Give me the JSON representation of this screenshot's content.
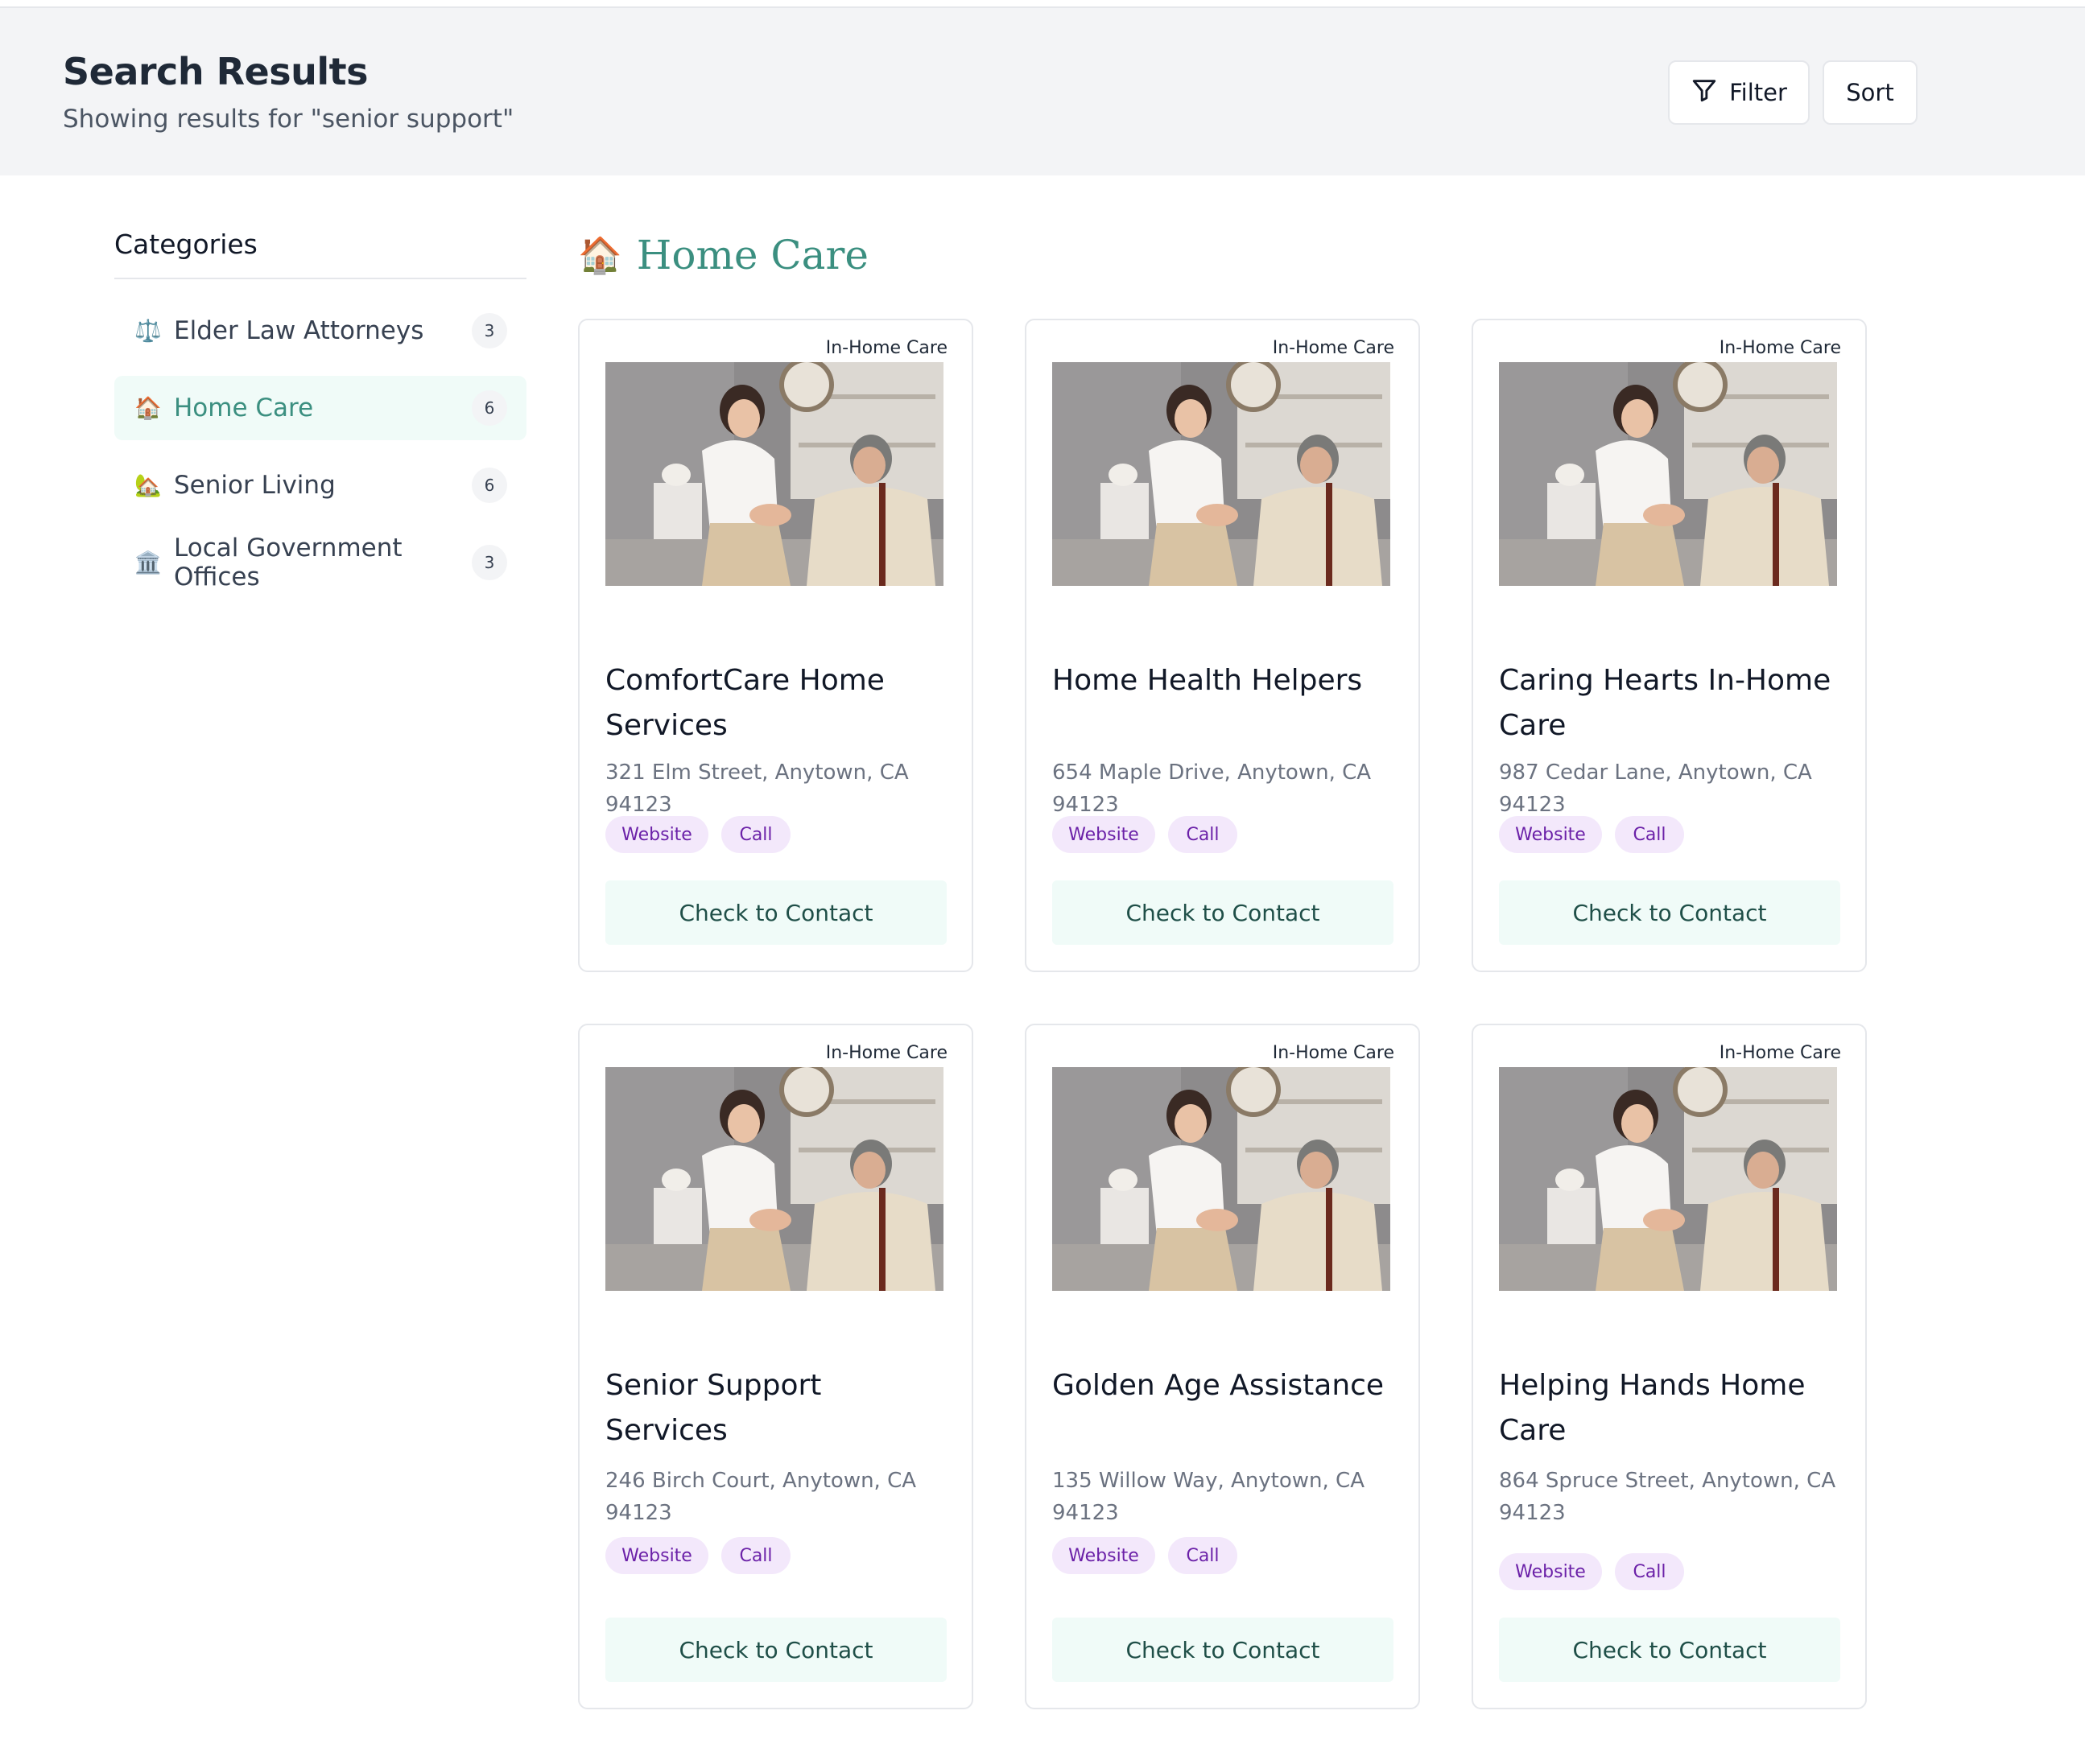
{
  "header": {
    "title": "Search Results",
    "subtitle": "Showing results for \"senior support\"",
    "filter_label": "Filter",
    "sort_label": "Sort"
  },
  "sidebar": {
    "title": "Categories",
    "items": [
      {
        "icon": "⚖️",
        "label": "Elder Law Attorneys",
        "count": "3",
        "active": false
      },
      {
        "icon": "🏠",
        "label": "Home Care",
        "count": "6",
        "active": true
      },
      {
        "icon": "🏡",
        "label": "Senior Living",
        "count": "6",
        "active": false
      },
      {
        "icon": "🏛️",
        "label": "Local Government Offices",
        "count": "3",
        "active": false
      }
    ]
  },
  "section": {
    "icon": "🏠",
    "title": "Home Care"
  },
  "cards": [
    {
      "tag": "In-Home Care",
      "name": "ComfortCare Home Services",
      "address": "321 Elm Street, Anytown, CA 94123",
      "website_label": "Website",
      "call_label": "Call",
      "contact_label": "Check to Contact"
    },
    {
      "tag": "In-Home Care",
      "name": "Home Health Helpers",
      "address": "654 Maple Drive, Anytown, CA 94123",
      "website_label": "Website",
      "call_label": "Call",
      "contact_label": "Check to Contact"
    },
    {
      "tag": "In-Home Care",
      "name": "Caring Hearts In-Home Care",
      "address": "987 Cedar Lane, Anytown, CA 94123",
      "website_label": "Website",
      "call_label": "Call",
      "contact_label": "Check to Contact"
    },
    {
      "tag": "In-Home Care",
      "name": "Senior Support Services",
      "address": "246 Birch Court, Anytown, CA 94123",
      "website_label": "Website",
      "call_label": "Call",
      "contact_label": "Check to Contact"
    },
    {
      "tag": "In-Home Care",
      "name": "Golden Age Assistance",
      "address": "135 Willow Way, Anytown, CA 94123",
      "website_label": "Website",
      "call_label": "Call",
      "contact_label": "Check to Contact"
    },
    {
      "tag": "In-Home Care",
      "name": "Helping Hands Home Care",
      "address": "864 Spruce Street, Anytown, CA 94123",
      "website_label": "Website",
      "call_label": "Call",
      "contact_label": "Check to Contact"
    }
  ],
  "colors": {
    "accent": "#3b8f80",
    "header_bg": "#f3f4f6",
    "pill_bg": "#f3e8fb",
    "pill_text": "#6b21a8",
    "contact_bg": "#f0fbf8"
  }
}
